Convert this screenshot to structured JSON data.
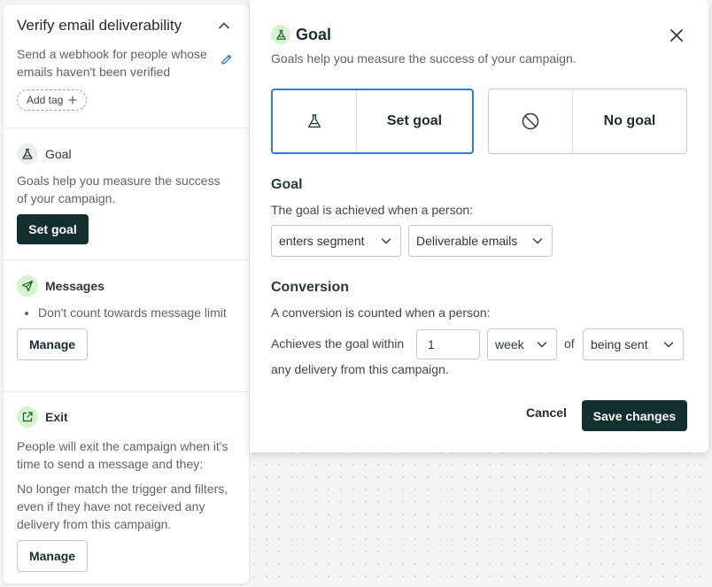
{
  "sidebar": {
    "header": {
      "title": "Verify email deliverability",
      "description": "Send a webhook for people whose emails haven't been verified",
      "add_tag_label": "Add tag"
    },
    "goal": {
      "title": "Goal",
      "description": "Goals help you measure the success of your campaign.",
      "button_label": "Set goal"
    },
    "messages": {
      "title": "Messages",
      "bullets": [
        "Don't count towards message limit"
      ],
      "button_label": "Manage"
    },
    "exit": {
      "title": "Exit",
      "description1": "People will exit the campaign when it's time to send a message and they:",
      "description2": "No longer match the trigger and filters, even if they have not received any delivery from this campaign.",
      "button_label": "Manage"
    }
  },
  "modal": {
    "title": "Goal",
    "subtitle": "Goals help you measure the success of your campaign.",
    "options": [
      {
        "label": "Set goal",
        "selected": true
      },
      {
        "label": "No goal",
        "selected": false
      }
    ],
    "goal_section": {
      "heading": "Goal",
      "text": "The goal is achieved when a person:",
      "condition_select": "enters segment",
      "segment_select": "Deliverable emails"
    },
    "conversion_section": {
      "heading": "Conversion",
      "text": "A conversion is counted when a person:",
      "prefix": "Achieves the goal within",
      "amount": "1",
      "unit_select": "week",
      "of_label": "of",
      "event_select": "being sent",
      "suffix": "any delivery from this campaign."
    },
    "cancel_label": "Cancel",
    "save_label": "Save changes"
  },
  "colors": {
    "primary_dark": "#14302e",
    "selected_border": "#2e7cd6",
    "icon_green_bg": "#d6f2d1"
  }
}
